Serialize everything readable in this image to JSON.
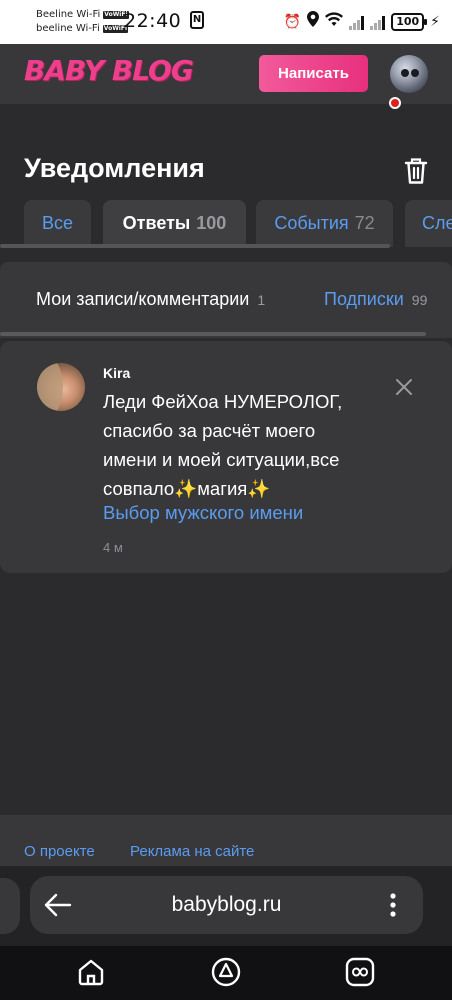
{
  "status_bar": {
    "carrier1": "Beeline Wi-Fi",
    "carrier2": "beeline Wi-Fi",
    "volte": "VoWiFi",
    "time": "22:40",
    "nfc": "N",
    "battery": "100"
  },
  "header": {
    "logo": "BABY BLOG",
    "write_button": "Написать"
  },
  "page": {
    "title": "Уведомления"
  },
  "tabs": [
    {
      "label": "Все",
      "count": ""
    },
    {
      "label": "Ответы",
      "count": "100"
    },
    {
      "label": "События",
      "count": "72"
    },
    {
      "label": "Сле",
      "count": ""
    }
  ],
  "subtabs": [
    {
      "label": "Мои записи/комментарии",
      "count": "1"
    },
    {
      "label": "Подписки",
      "count": "99"
    }
  ],
  "notification": {
    "user": "Kira",
    "text": "Леди ФейХоа НУМЕРОЛОГ, спасибо за расчёт моего имени и моей ситуации,все совпало✨магия✨",
    "link": "Выбор мужского имени",
    "time": "4 м"
  },
  "footer": {
    "links": [
      "О проекте",
      "Реклама на сайте"
    ]
  },
  "browser": {
    "url": "babyblog.ru"
  },
  "colors": {
    "accent_pink": "#ee3f8c",
    "link_blue": "#5b9cf0",
    "background": "#2b2b2d",
    "panel": "#38383b"
  }
}
